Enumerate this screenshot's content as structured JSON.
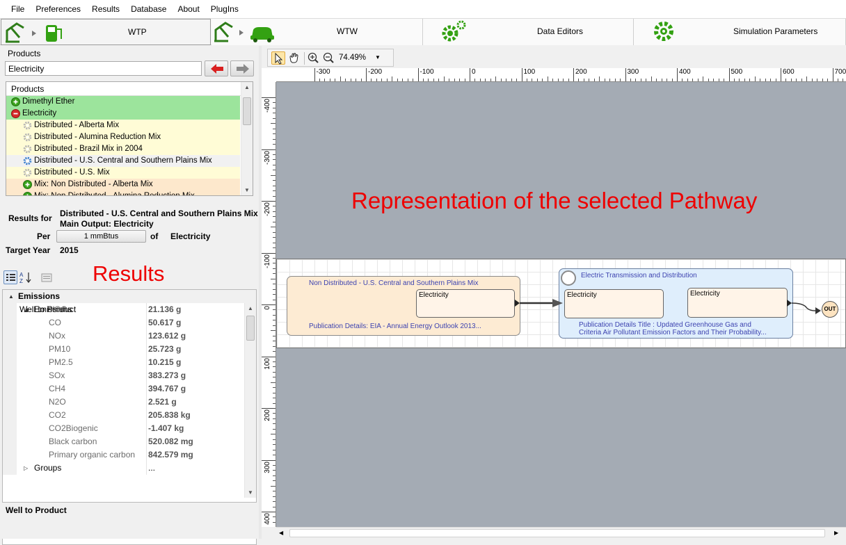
{
  "menu": [
    "File",
    "Preferences",
    "Results",
    "Database",
    "About",
    "PlugIns"
  ],
  "mode_tabs": [
    {
      "label": "WTP",
      "icon": "pump-to-fuel-icon"
    },
    {
      "label": "WTW",
      "icon": "pump-to-car-icon"
    },
    {
      "label": "Data Editors",
      "icon": "gears-icon"
    },
    {
      "label": "Simulation Parameters",
      "icon": "gear-icon"
    }
  ],
  "products_panel": {
    "group_label": "Products",
    "search_value": "Electricity",
    "list_header": "Products",
    "items": [
      {
        "label": "Dimethyl Ether",
        "style": "green",
        "icon": "expand-plus-icon",
        "indent": 0
      },
      {
        "label": "Electricity",
        "style": "green",
        "icon": "collapse-minus-icon",
        "indent": 0
      },
      {
        "label": "Distributed - Alberta Mix",
        "style": "yellow",
        "icon": "grey-gear-icon",
        "indent": 1
      },
      {
        "label": "Distributed - Alumina Reduction Mix",
        "style": "yellow",
        "icon": "grey-gear-icon",
        "indent": 1
      },
      {
        "label": "Distributed - Brazil Mix in 2004",
        "style": "yellow",
        "icon": "grey-gear-icon",
        "indent": 1
      },
      {
        "label": "Distributed - U.S. Central and Southern Plains Mix",
        "style": "white",
        "icon": "blue-gear-icon",
        "indent": 1
      },
      {
        "label": "Distributed - U.S. Mix",
        "style": "yellow",
        "icon": "grey-gear-icon",
        "indent": 1
      },
      {
        "label": "Mix: Non Distributed - Alberta Mix",
        "style": "orange",
        "icon": "expand-plus-icon",
        "indent": 1
      },
      {
        "label": "Mix: Non Distributed - Alumina Reduction Mix",
        "style": "orange",
        "icon": "expand-plus-icon",
        "indent": 1
      }
    ]
  },
  "results": {
    "results_for_label": "Results for",
    "pathway_name": "Distributed - U.S. Central and Southern Plains Mix",
    "main_output": "Main Output: Electricity",
    "per_label": "Per",
    "per_value": "1 mmBtus",
    "of_label": "of",
    "of_value": "Electricity",
    "target_year_label": "Target Year",
    "target_year": "2015",
    "annotation": "Results"
  },
  "property_grid": {
    "rows": [
      {
        "name": "Emissions",
        "value": "",
        "kind": "cat",
        "level": 0,
        "toggle": "▲"
      },
      {
        "name": "Well to Product",
        "value": "...",
        "kind": "node",
        "level": 0,
        "toggle": "◢"
      },
      {
        "name": "Emissions",
        "value": "...",
        "kind": "node",
        "level": 1,
        "toggle": "◢"
      },
      {
        "name": "VOC",
        "value": "21.136 g",
        "kind": "leaf",
        "level": 2
      },
      {
        "name": "CO",
        "value": "50.617 g",
        "kind": "leaf",
        "level": 2
      },
      {
        "name": "NOx",
        "value": "123.612 g",
        "kind": "leaf",
        "level": 2
      },
      {
        "name": "PM10",
        "value": "25.723 g",
        "kind": "leaf",
        "level": 2
      },
      {
        "name": "PM2.5",
        "value": "10.215 g",
        "kind": "leaf",
        "level": 2
      },
      {
        "name": "SOx",
        "value": "383.273 g",
        "kind": "leaf",
        "level": 2
      },
      {
        "name": "CH4",
        "value": "394.767 g",
        "kind": "leaf",
        "level": 2
      },
      {
        "name": "N2O",
        "value": "2.521 g",
        "kind": "leaf",
        "level": 2
      },
      {
        "name": "CO2",
        "value": "205.838 kg",
        "kind": "leaf",
        "level": 2
      },
      {
        "name": "CO2Biogenic",
        "value": "-1.407 kg",
        "kind": "leaf",
        "level": 2
      },
      {
        "name": "Black carbon",
        "value": "520.082 mg",
        "kind": "leaf",
        "level": 2
      },
      {
        "name": "Primary organic carbon",
        "value": "842.579 mg",
        "kind": "leaf",
        "level": 2
      },
      {
        "name": "Groups",
        "value": "...",
        "kind": "node",
        "level": 1,
        "toggle": "▷"
      }
    ],
    "description_title": "Well to Product"
  },
  "canvas": {
    "zoom": "74.49%",
    "hruler_ticks": [
      "-300",
      "-200",
      "-100",
      "0",
      "100",
      "200",
      "300",
      "400",
      "500",
      "600",
      "700"
    ],
    "vruler_ticks": [
      "-400",
      "-300",
      "-200",
      "-100",
      "0",
      "100",
      "200",
      "300",
      "400"
    ],
    "annotation": "Representation of the selected Pathway",
    "node1": {
      "title": "Non Distributed - U.S. Central and Southern Plains Mix",
      "output": "Electricity",
      "publication": "Publication Details: EIA - Annual Energy Outlook 2013...",
      "fill": "#fdebd3"
    },
    "node2": {
      "title": "Electric Transmission and Distribution",
      "input": "Electricity",
      "output": "Electricity",
      "publication_line1": "Publication Details Title : Updated Greenhouse Gas and",
      "publication_line2": "Criteria Air Pollutant Emission Factors and Their Probability...",
      "fill": "#dfeefc"
    },
    "out_label": "OUT"
  },
  "colors": {
    "annotation": "#ee0000",
    "node_text": "#3d43b0",
    "canvas_bg": "#a4abb4"
  }
}
